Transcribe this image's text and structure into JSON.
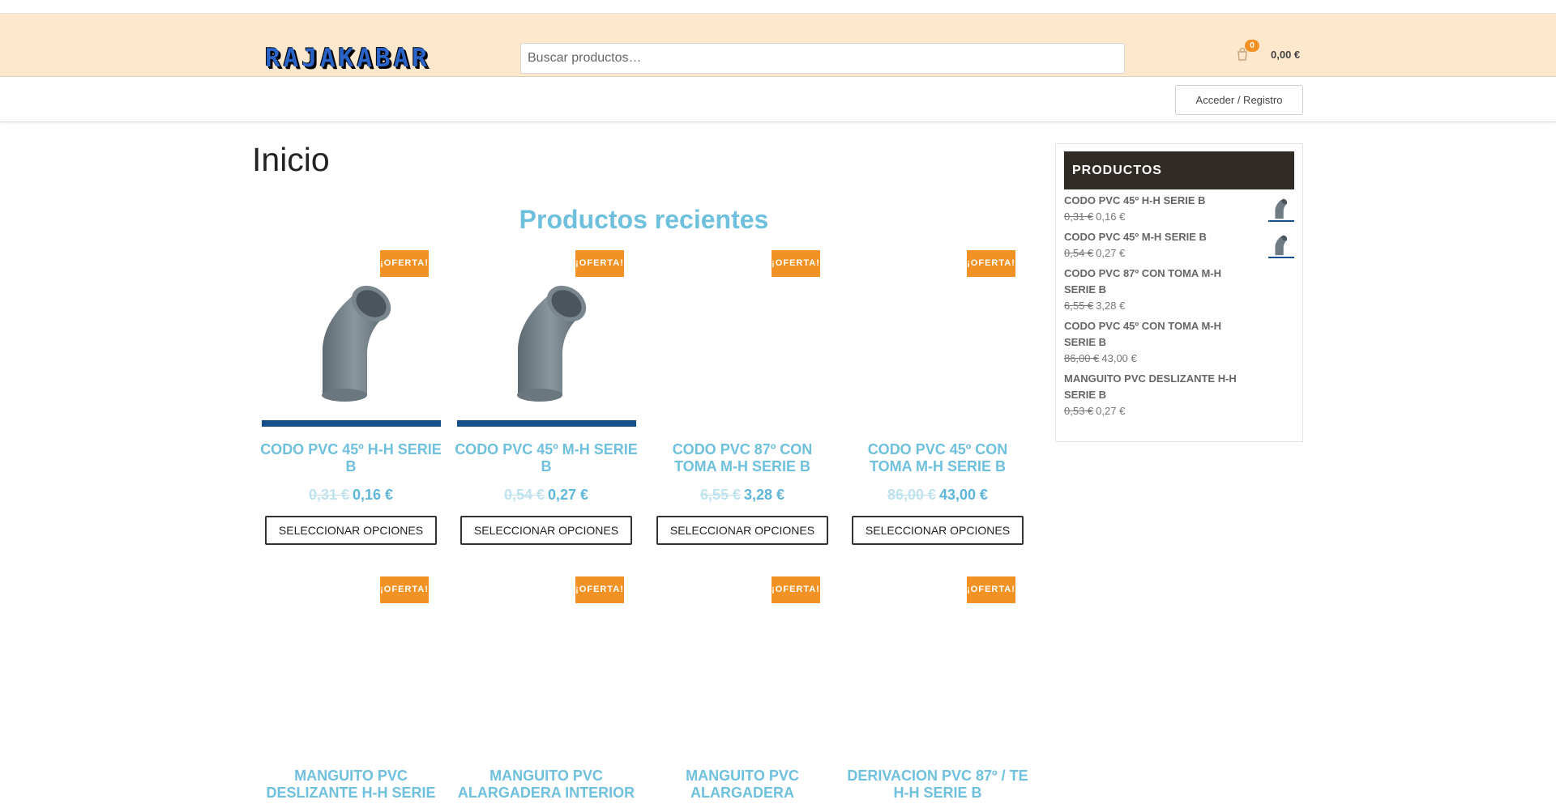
{
  "header": {
    "logo_text": "RAJAKABAR",
    "search_placeholder": "Buscar productos…",
    "cart_count": "0",
    "cart_total": "0,00 €"
  },
  "nav": {
    "login_label": "Acceder / Registro"
  },
  "page": {
    "title": "Inicio",
    "section_title": "Productos recientes"
  },
  "badge_label": "¡OFERTA!",
  "button_label": "SELECCIONAR OPCIONES",
  "products": [
    {
      "name": "CODO PVC 45º H-H SERIE B",
      "old_price": "0,31 €",
      "price": "0,16 €",
      "has_image": true
    },
    {
      "name": "CODO PVC 45º M-H SERIE B",
      "old_price": "0,54 €",
      "price": "0,27 €",
      "has_image": true
    },
    {
      "name": "CODO PVC 87º CON TOMA M-H SERIE B",
      "old_price": "6,55 €",
      "price": "3,28 €",
      "has_image": false
    },
    {
      "name": "CODO PVC 45º CON TOMA M-H SERIE B",
      "old_price": "86,00 €",
      "price": "43,00 €",
      "has_image": false
    },
    {
      "name": "MANGUITO PVC DESLIZANTE H-H SERIE",
      "has_image": false
    },
    {
      "name": "MANGUITO PVC ALARGADERA INTERIOR",
      "has_image": false
    },
    {
      "name": "MANGUITO PVC ALARGADERA",
      "has_image": false
    },
    {
      "name": "DERIVACION PVC 87º / TE H-H SERIE B",
      "has_image": false
    }
  ],
  "sidebar": {
    "title": "PRODUCTOS",
    "items": [
      {
        "name": "CODO PVC 45º H-H SERIE B",
        "old_price": "0,31 €",
        "price": "0,16 €",
        "has_image": true
      },
      {
        "name": "CODO PVC 45º M-H SERIE B",
        "old_price": "0,54 €",
        "price": "0,27 €",
        "has_image": true
      },
      {
        "name": "CODO PVC 87º CON TOMA M-H SERIE B",
        "old_price": "6,55 €",
        "price": "3,28 €",
        "has_image": false
      },
      {
        "name": "CODO PVC 45º CON TOMA M-H SERIE B",
        "old_price": "86,00 €",
        "price": "43,00 €",
        "has_image": false
      },
      {
        "name": "MANGUITO PVC DESLIZANTE H-H SERIE B",
        "old_price": "0,53 €",
        "price": "0,27 €",
        "has_image": false
      }
    ]
  },
  "colors": {
    "header_bg": "#fde8cd",
    "accent": "#6fc0dd",
    "badge": "#f39224",
    "widget_title_bg": "#312b26"
  }
}
